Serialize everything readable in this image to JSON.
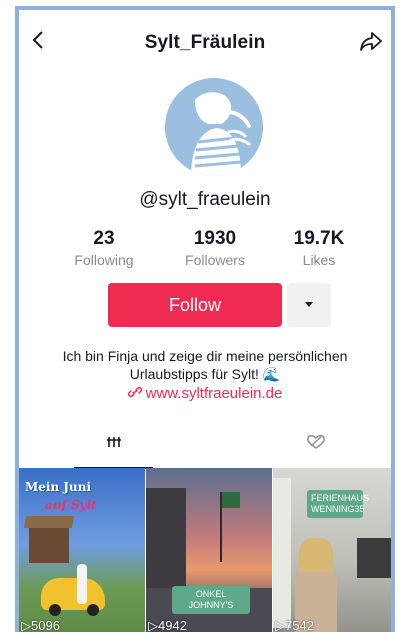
{
  "header": {
    "title": "Sylt_Fräulein",
    "back_icon": "chevron-left-icon",
    "share_icon": "share-arrow-icon"
  },
  "profile": {
    "handle": "@sylt_fraeulein",
    "stats": [
      {
        "value": "23",
        "label": "Following"
      },
      {
        "value": "1930",
        "label": "Followers"
      },
      {
        "value": "19.7K",
        "label": "Likes"
      }
    ],
    "follow_label": "Follow",
    "bio": "Ich bin Finja und zeige dir meine persönlichen Urlaubstipps für Sylt! 🌊",
    "link": "www.syltfraeulein.de"
  },
  "tabs": [
    {
      "icon": "grid-icon",
      "selected": true
    },
    {
      "icon": "liked-heart-icon",
      "selected": false
    }
  ],
  "videos": [
    {
      "views": "▷5096",
      "title": "Mein Juni",
      "subtitle": "auf Sylt"
    },
    {
      "views": "▷4942",
      "badge": "ONKEL JOHNNY'S"
    },
    {
      "views": "▷7542",
      "badge": "FERIENHAUS WENNING35"
    }
  ],
  "colors": {
    "accent": "#ef2b52",
    "frame": "#8fb1d8",
    "avatar_bg": "#9dbfdf"
  }
}
